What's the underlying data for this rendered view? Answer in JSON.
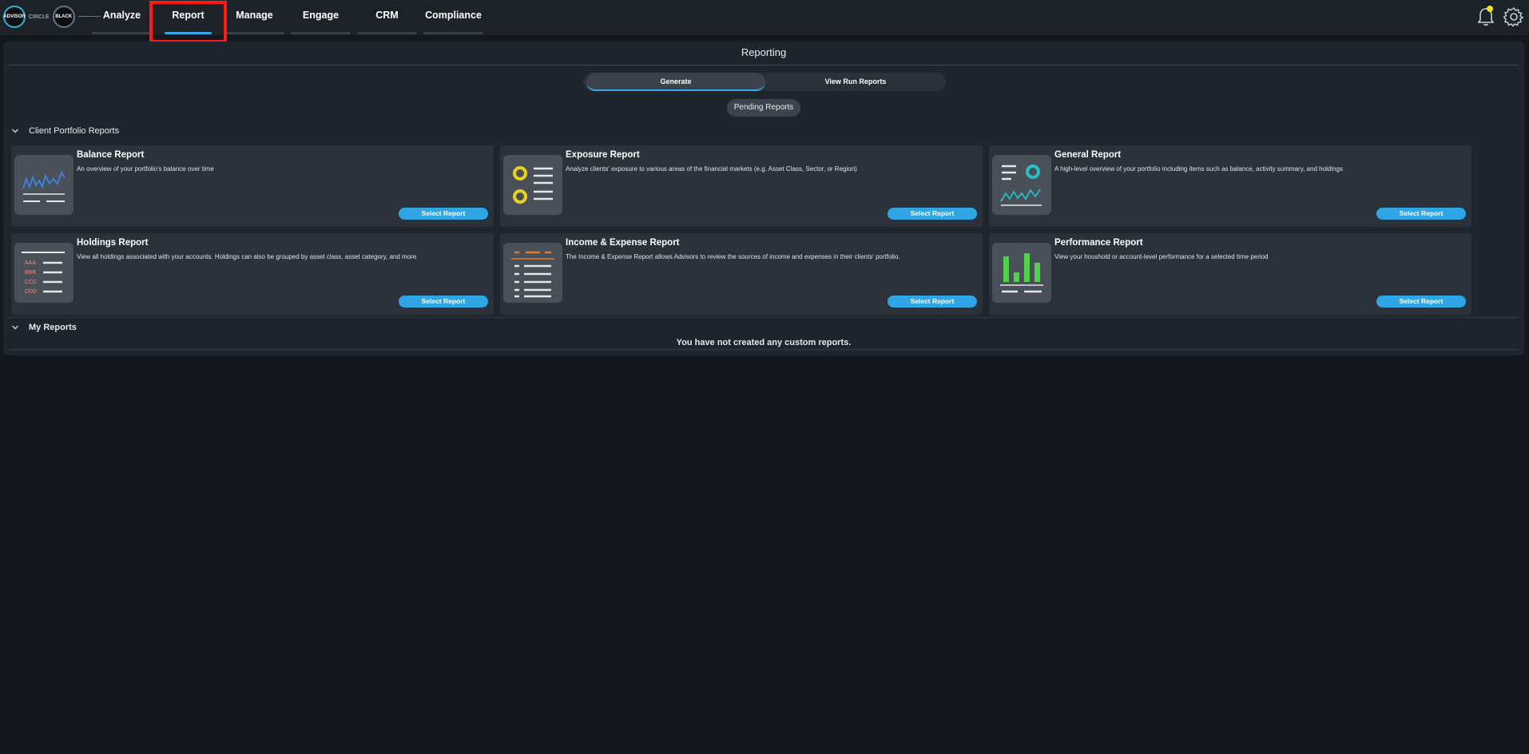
{
  "logo": {
    "left_text": "ADVISOR",
    "middle_text": "CIRCLE",
    "right_text": "BLACK"
  },
  "nav": {
    "items": [
      {
        "label": "Analyze"
      },
      {
        "label": "Report"
      },
      {
        "label": "Manage"
      },
      {
        "label": "Engage"
      },
      {
        "label": "CRM"
      },
      {
        "label": "Compliance"
      }
    ],
    "active": "Report"
  },
  "header_icons": {
    "bell": "bell-icon",
    "settings": "gear-icon",
    "notification_dot_color": "#f2e21b"
  },
  "reporting": {
    "title": "Reporting",
    "tabs": {
      "generate": "Generate",
      "view_run": "View Run Reports"
    },
    "pending_label": "Pending Reports"
  },
  "sections": {
    "client_portfolio": "Client Portfolio Reports",
    "my_reports": "My Reports",
    "empty_message": "You have not created any custom reports."
  },
  "cards": [
    {
      "title": "Balance Report",
      "desc": "An overview of your portfolio's balance over time",
      "button": "Select Report",
      "icon": "balance-chart-icon"
    },
    {
      "title": "Exposure Report",
      "desc": "Analyze clients' exposure to various areas of the financial markets (e.g. Asset Class, Sector, or Region)",
      "button": "Select Report",
      "icon": "exposure-list-icon"
    },
    {
      "title": "General Report",
      "desc": "A high-level overview of your portfolio including items such as balance, activity summary, and holdings",
      "button": "Select Report",
      "icon": "general-overview-icon"
    },
    {
      "title": "Holdings Report",
      "desc": "View all holdings associated with your accounts. Holdings can also be grouped by asset class, asset category, and more",
      "button": "Select Report",
      "icon": "holdings-list-icon"
    },
    {
      "title": "Income & Expense Report",
      "desc": "The Income & Expense Report allows Advisors to review the sources of income and expenses in their clients' portfolio.",
      "button": "Select Report",
      "icon": "income-expense-icon"
    },
    {
      "title": "Performance Report",
      "desc": "View your houshold or account-level performance for a selected time period",
      "button": "Select Report",
      "icon": "performance-bars-icon"
    }
  ],
  "holdings_icon_labels": [
    "AAA",
    "BBB",
    "CCC",
    "DDD"
  ],
  "colors": {
    "accent": "#3aa7e8",
    "button": "#2fa5e6",
    "highlight": "#ff1a1a"
  }
}
